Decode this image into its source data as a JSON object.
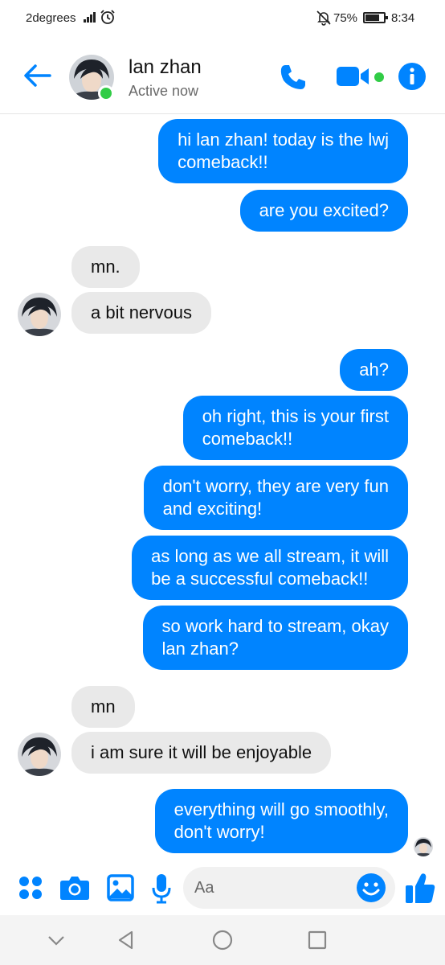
{
  "status_bar": {
    "carrier": "2degrees",
    "battery_percent": "75%",
    "battery_level": 0.75,
    "time": "8:34"
  },
  "header": {
    "contact_name": "lan zhan",
    "status": "Active now"
  },
  "icons": {
    "back": "arrow-left-icon",
    "call": "phone-icon",
    "video": "video-camera-icon",
    "info": "info-icon",
    "menu": "four-dots-icon",
    "camera": "camera-icon",
    "gallery": "image-icon",
    "mic": "microphone-icon",
    "emoji": "smiley-icon",
    "like": "thumbs-up-icon"
  },
  "colors": {
    "accent": "#0084ff",
    "outgoing_bubble": "#0084ff",
    "incoming_bubble": "#e9e9e9",
    "online": "#31cc46"
  },
  "messages": [
    {
      "from": "me",
      "text": "hi lan zhan! today is the lwj\ncomeback!!"
    },
    {
      "from": "me",
      "text": "are you excited?"
    },
    {
      "from": "them",
      "text": "mn."
    },
    {
      "from": "them",
      "text": "a bit nervous"
    },
    {
      "from": "me",
      "text": "ah?"
    },
    {
      "from": "me",
      "text": "oh right, this is your first\ncomeback!!"
    },
    {
      "from": "me",
      "text": "don't worry, they are very fun\nand exciting!"
    },
    {
      "from": "me",
      "text": "as long as we all stream, it will\nbe a successful comeback!!"
    },
    {
      "from": "me",
      "text": "so work hard to stream, okay\nlan zhan?"
    },
    {
      "from": "them",
      "text": "mn"
    },
    {
      "from": "them",
      "text": "i am sure it will be enjoyable"
    },
    {
      "from": "me",
      "text": "everything will go smoothly,\ndon't worry!"
    }
  ],
  "composer": {
    "placeholder": "Aa"
  }
}
